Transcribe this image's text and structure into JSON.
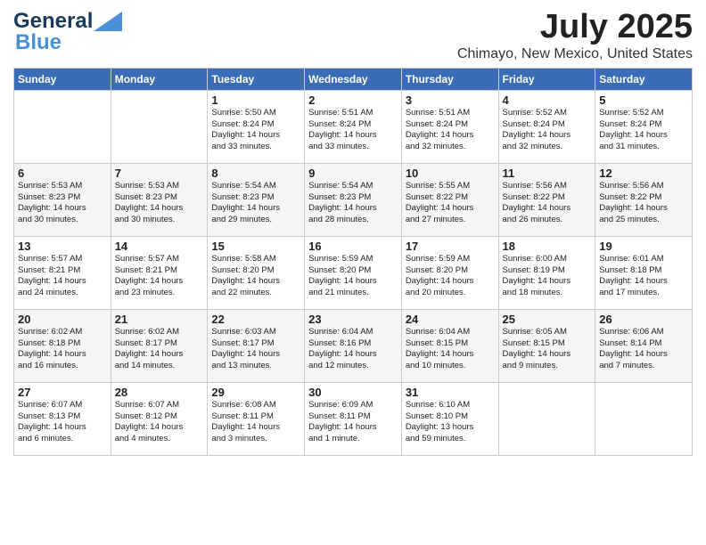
{
  "header": {
    "logo_line1": "General",
    "logo_line2": "Blue",
    "month": "July 2025",
    "location": "Chimayo, New Mexico, United States"
  },
  "weekdays": [
    "Sunday",
    "Monday",
    "Tuesday",
    "Wednesday",
    "Thursday",
    "Friday",
    "Saturday"
  ],
  "weeks": [
    [
      {
        "day": "",
        "info": ""
      },
      {
        "day": "",
        "info": ""
      },
      {
        "day": "1",
        "info": "Sunrise: 5:50 AM\nSunset: 8:24 PM\nDaylight: 14 hours\nand 33 minutes."
      },
      {
        "day": "2",
        "info": "Sunrise: 5:51 AM\nSunset: 8:24 PM\nDaylight: 14 hours\nand 33 minutes."
      },
      {
        "day": "3",
        "info": "Sunrise: 5:51 AM\nSunset: 8:24 PM\nDaylight: 14 hours\nand 32 minutes."
      },
      {
        "day": "4",
        "info": "Sunrise: 5:52 AM\nSunset: 8:24 PM\nDaylight: 14 hours\nand 32 minutes."
      },
      {
        "day": "5",
        "info": "Sunrise: 5:52 AM\nSunset: 8:24 PM\nDaylight: 14 hours\nand 31 minutes."
      }
    ],
    [
      {
        "day": "6",
        "info": "Sunrise: 5:53 AM\nSunset: 8:23 PM\nDaylight: 14 hours\nand 30 minutes."
      },
      {
        "day": "7",
        "info": "Sunrise: 5:53 AM\nSunset: 8:23 PM\nDaylight: 14 hours\nand 30 minutes."
      },
      {
        "day": "8",
        "info": "Sunrise: 5:54 AM\nSunset: 8:23 PM\nDaylight: 14 hours\nand 29 minutes."
      },
      {
        "day": "9",
        "info": "Sunrise: 5:54 AM\nSunset: 8:23 PM\nDaylight: 14 hours\nand 28 minutes."
      },
      {
        "day": "10",
        "info": "Sunrise: 5:55 AM\nSunset: 8:22 PM\nDaylight: 14 hours\nand 27 minutes."
      },
      {
        "day": "11",
        "info": "Sunrise: 5:56 AM\nSunset: 8:22 PM\nDaylight: 14 hours\nand 26 minutes."
      },
      {
        "day": "12",
        "info": "Sunrise: 5:56 AM\nSunset: 8:22 PM\nDaylight: 14 hours\nand 25 minutes."
      }
    ],
    [
      {
        "day": "13",
        "info": "Sunrise: 5:57 AM\nSunset: 8:21 PM\nDaylight: 14 hours\nand 24 minutes."
      },
      {
        "day": "14",
        "info": "Sunrise: 5:57 AM\nSunset: 8:21 PM\nDaylight: 14 hours\nand 23 minutes."
      },
      {
        "day": "15",
        "info": "Sunrise: 5:58 AM\nSunset: 8:20 PM\nDaylight: 14 hours\nand 22 minutes."
      },
      {
        "day": "16",
        "info": "Sunrise: 5:59 AM\nSunset: 8:20 PM\nDaylight: 14 hours\nand 21 minutes."
      },
      {
        "day": "17",
        "info": "Sunrise: 5:59 AM\nSunset: 8:20 PM\nDaylight: 14 hours\nand 20 minutes."
      },
      {
        "day": "18",
        "info": "Sunrise: 6:00 AM\nSunset: 8:19 PM\nDaylight: 14 hours\nand 18 minutes."
      },
      {
        "day": "19",
        "info": "Sunrise: 6:01 AM\nSunset: 8:18 PM\nDaylight: 14 hours\nand 17 minutes."
      }
    ],
    [
      {
        "day": "20",
        "info": "Sunrise: 6:02 AM\nSunset: 8:18 PM\nDaylight: 14 hours\nand 16 minutes."
      },
      {
        "day": "21",
        "info": "Sunrise: 6:02 AM\nSunset: 8:17 PM\nDaylight: 14 hours\nand 14 minutes."
      },
      {
        "day": "22",
        "info": "Sunrise: 6:03 AM\nSunset: 8:17 PM\nDaylight: 14 hours\nand 13 minutes."
      },
      {
        "day": "23",
        "info": "Sunrise: 6:04 AM\nSunset: 8:16 PM\nDaylight: 14 hours\nand 12 minutes."
      },
      {
        "day": "24",
        "info": "Sunrise: 6:04 AM\nSunset: 8:15 PM\nDaylight: 14 hours\nand 10 minutes."
      },
      {
        "day": "25",
        "info": "Sunrise: 6:05 AM\nSunset: 8:15 PM\nDaylight: 14 hours\nand 9 minutes."
      },
      {
        "day": "26",
        "info": "Sunrise: 6:06 AM\nSunset: 8:14 PM\nDaylight: 14 hours\nand 7 minutes."
      }
    ],
    [
      {
        "day": "27",
        "info": "Sunrise: 6:07 AM\nSunset: 8:13 PM\nDaylight: 14 hours\nand 6 minutes."
      },
      {
        "day": "28",
        "info": "Sunrise: 6:07 AM\nSunset: 8:12 PM\nDaylight: 14 hours\nand 4 minutes."
      },
      {
        "day": "29",
        "info": "Sunrise: 6:08 AM\nSunset: 8:11 PM\nDaylight: 14 hours\nand 3 minutes."
      },
      {
        "day": "30",
        "info": "Sunrise: 6:09 AM\nSunset: 8:11 PM\nDaylight: 14 hours\nand 1 minute."
      },
      {
        "day": "31",
        "info": "Sunrise: 6:10 AM\nSunset: 8:10 PM\nDaylight: 13 hours\nand 59 minutes."
      },
      {
        "day": "",
        "info": ""
      },
      {
        "day": "",
        "info": ""
      }
    ]
  ]
}
